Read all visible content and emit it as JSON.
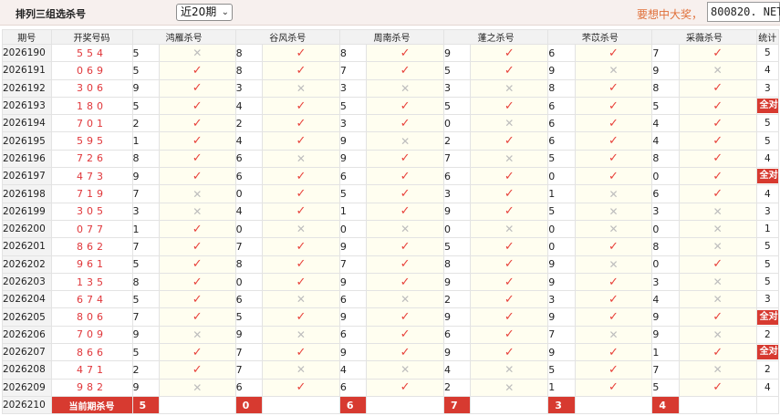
{
  "header": {
    "title": "排列三组选杀号",
    "period_select": "近20期",
    "promo": "要想中大奖，"
  },
  "watermark": "800820. NET",
  "columns": {
    "issue": "期号",
    "win": "开奖号码",
    "experts": [
      "鸿雁杀号",
      "谷风杀号",
      "周南杀号",
      "蓬之杀号",
      "芣苡杀号",
      "采薇杀号"
    ],
    "stat": "统计"
  },
  "rows": [
    {
      "issue": "2026190",
      "win": "554",
      "kills": [
        [
          "5",
          "no"
        ],
        [
          "8",
          "ok"
        ],
        [
          "8",
          "ok"
        ],
        [
          "9",
          "ok"
        ],
        [
          "6",
          "ok"
        ],
        [
          "7",
          "ok"
        ]
      ],
      "stat": "5"
    },
    {
      "issue": "2026191",
      "win": "069",
      "kills": [
        [
          "5",
          "ok"
        ],
        [
          "8",
          "ok"
        ],
        [
          "7",
          "ok"
        ],
        [
          "5",
          "ok"
        ],
        [
          "9",
          "no"
        ],
        [
          "9",
          "no"
        ]
      ],
      "stat": "4"
    },
    {
      "issue": "2026192",
      "win": "306",
      "kills": [
        [
          "9",
          "ok"
        ],
        [
          "3",
          "no"
        ],
        [
          "3",
          "no"
        ],
        [
          "3",
          "no"
        ],
        [
          "8",
          "ok"
        ],
        [
          "8",
          "ok"
        ]
      ],
      "stat": "3"
    },
    {
      "issue": "2026193",
      "win": "180",
      "kills": [
        [
          "5",
          "ok"
        ],
        [
          "4",
          "ok"
        ],
        [
          "5",
          "ok"
        ],
        [
          "5",
          "ok"
        ],
        [
          "6",
          "ok"
        ],
        [
          "5",
          "ok"
        ]
      ],
      "stat": "全对"
    },
    {
      "issue": "2026194",
      "win": "701",
      "kills": [
        [
          "2",
          "ok"
        ],
        [
          "2",
          "ok"
        ],
        [
          "3",
          "ok"
        ],
        [
          "0",
          "no"
        ],
        [
          "6",
          "ok"
        ],
        [
          "4",
          "ok"
        ]
      ],
      "stat": "5"
    },
    {
      "issue": "2026195",
      "win": "595",
      "kills": [
        [
          "1",
          "ok"
        ],
        [
          "4",
          "ok"
        ],
        [
          "9",
          "no"
        ],
        [
          "2",
          "ok"
        ],
        [
          "6",
          "ok"
        ],
        [
          "4",
          "ok"
        ]
      ],
      "stat": "5"
    },
    {
      "issue": "2026196",
      "win": "726",
      "kills": [
        [
          "8",
          "ok"
        ],
        [
          "6",
          "no"
        ],
        [
          "9",
          "ok"
        ],
        [
          "7",
          "no"
        ],
        [
          "5",
          "ok"
        ],
        [
          "8",
          "ok"
        ]
      ],
      "stat": "4"
    },
    {
      "issue": "2026197",
      "win": "473",
      "kills": [
        [
          "9",
          "ok"
        ],
        [
          "6",
          "ok"
        ],
        [
          "6",
          "ok"
        ],
        [
          "6",
          "ok"
        ],
        [
          "0",
          "ok"
        ],
        [
          "0",
          "ok"
        ]
      ],
      "stat": "全对"
    },
    {
      "issue": "2026198",
      "win": "719",
      "kills": [
        [
          "7",
          "no"
        ],
        [
          "0",
          "ok"
        ],
        [
          "5",
          "ok"
        ],
        [
          "3",
          "ok"
        ],
        [
          "1",
          "no"
        ],
        [
          "6",
          "ok"
        ]
      ],
      "stat": "4"
    },
    {
      "issue": "2026199",
      "win": "305",
      "kills": [
        [
          "3",
          "no"
        ],
        [
          "4",
          "ok"
        ],
        [
          "1",
          "ok"
        ],
        [
          "9",
          "ok"
        ],
        [
          "5",
          "no"
        ],
        [
          "3",
          "no"
        ]
      ],
      "stat": "3"
    },
    {
      "issue": "2026200",
      "win": "077",
      "kills": [
        [
          "1",
          "ok"
        ],
        [
          "0",
          "no"
        ],
        [
          "0",
          "no"
        ],
        [
          "0",
          "no"
        ],
        [
          "0",
          "no"
        ],
        [
          "0",
          "no"
        ]
      ],
      "stat": "1"
    },
    {
      "issue": "2026201",
      "win": "862",
      "kills": [
        [
          "7",
          "ok"
        ],
        [
          "7",
          "ok"
        ],
        [
          "9",
          "ok"
        ],
        [
          "5",
          "ok"
        ],
        [
          "0",
          "ok"
        ],
        [
          "8",
          "no"
        ]
      ],
      "stat": "5"
    },
    {
      "issue": "2026202",
      "win": "961",
      "kills": [
        [
          "5",
          "ok"
        ],
        [
          "8",
          "ok"
        ],
        [
          "7",
          "ok"
        ],
        [
          "8",
          "ok"
        ],
        [
          "9",
          "no"
        ],
        [
          "0",
          "ok"
        ]
      ],
      "stat": "5"
    },
    {
      "issue": "2026203",
      "win": "135",
      "kills": [
        [
          "8",
          "ok"
        ],
        [
          "0",
          "ok"
        ],
        [
          "9",
          "ok"
        ],
        [
          "9",
          "ok"
        ],
        [
          "9",
          "ok"
        ],
        [
          "3",
          "no"
        ]
      ],
      "stat": "5"
    },
    {
      "issue": "2026204",
      "win": "674",
      "kills": [
        [
          "5",
          "ok"
        ],
        [
          "6",
          "no"
        ],
        [
          "6",
          "no"
        ],
        [
          "2",
          "ok"
        ],
        [
          "3",
          "ok"
        ],
        [
          "4",
          "no"
        ]
      ],
      "stat": "3"
    },
    {
      "issue": "2026205",
      "win": "806",
      "kills": [
        [
          "7",
          "ok"
        ],
        [
          "5",
          "ok"
        ],
        [
          "9",
          "ok"
        ],
        [
          "9",
          "ok"
        ],
        [
          "9",
          "ok"
        ],
        [
          "9",
          "ok"
        ]
      ],
      "stat": "全对"
    },
    {
      "issue": "2026206",
      "win": "709",
      "kills": [
        [
          "9",
          "no"
        ],
        [
          "9",
          "no"
        ],
        [
          "6",
          "ok"
        ],
        [
          "6",
          "ok"
        ],
        [
          "7",
          "no"
        ],
        [
          "9",
          "no"
        ]
      ],
      "stat": "2"
    },
    {
      "issue": "2026207",
      "win": "866",
      "kills": [
        [
          "5",
          "ok"
        ],
        [
          "7",
          "ok"
        ],
        [
          "9",
          "ok"
        ],
        [
          "9",
          "ok"
        ],
        [
          "9",
          "ok"
        ],
        [
          "1",
          "ok"
        ]
      ],
      "stat": "全对"
    },
    {
      "issue": "2026208",
      "win": "471",
      "kills": [
        [
          "2",
          "ok"
        ],
        [
          "7",
          "no"
        ],
        [
          "4",
          "no"
        ],
        [
          "4",
          "no"
        ],
        [
          "5",
          "ok"
        ],
        [
          "7",
          "no"
        ]
      ],
      "stat": "2"
    },
    {
      "issue": "2026209",
      "win": "982",
      "kills": [
        [
          "9",
          "no"
        ],
        [
          "6",
          "ok"
        ],
        [
          "6",
          "ok"
        ],
        [
          "2",
          "no"
        ],
        [
          "1",
          "ok"
        ],
        [
          "5",
          "ok"
        ]
      ],
      "stat": "4"
    }
  ],
  "current": {
    "issue": "2026210",
    "label": "当前期杀号",
    "kills": [
      "5",
      "0",
      "6",
      "7",
      "3",
      "4"
    ]
  },
  "marks": {
    "ok": "✓",
    "no": "✕"
  },
  "colors": {
    "accent": "#d73a30",
    "ok": "#e8423b",
    "no": "#bdbdbd",
    "promo": "#e0703a"
  }
}
